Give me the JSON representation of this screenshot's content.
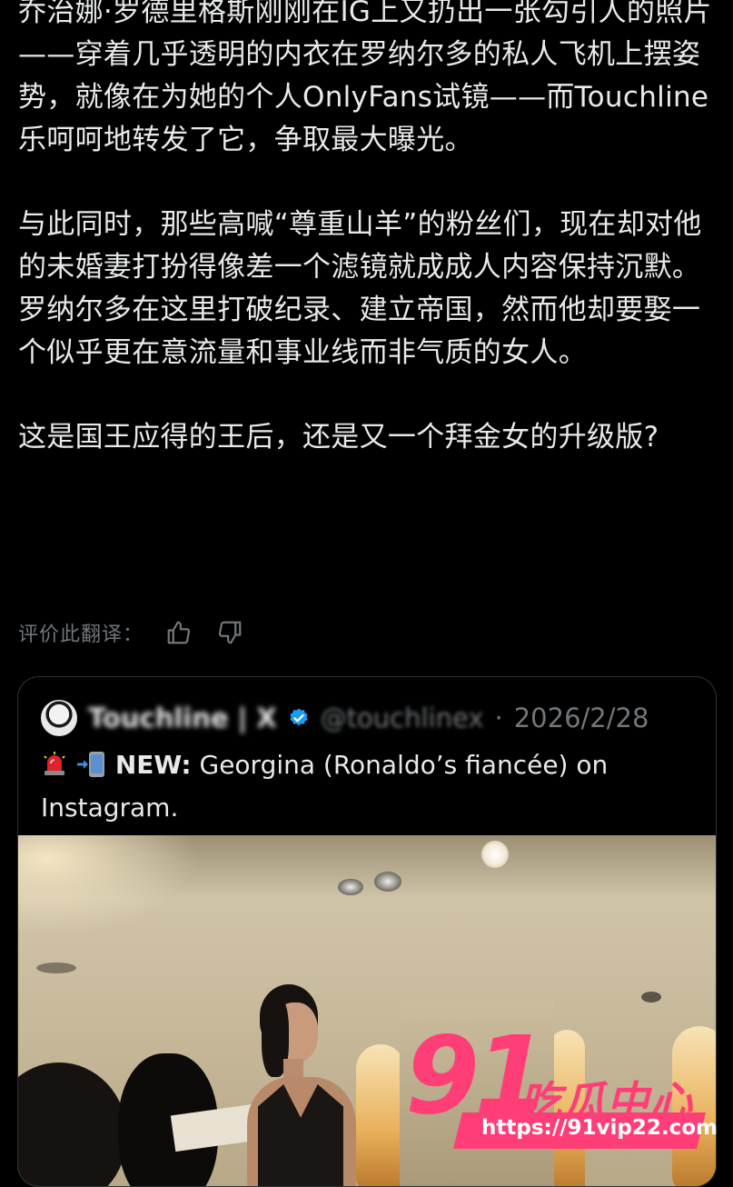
{
  "post": {
    "paragraphs": [
      "乔治娜·罗德里格斯刚刚在IG上又扔出一张勾引人的照片——穿着几乎透明的内衣在罗纳尔多的私人飞机上摆姿势，就像在为她的个人OnlyFans试镜——而Touchline乐呵呵地转发了它，争取最大曝光。",
      "与此同时，那些高喊“尊重山羊”的粉丝们，现在却对他的未婚妻打扮得像差一个滤镜就成成人内容保持沉默。罗纳尔多在这里打破纪录、建立帝国，然而他却要娶一个似乎更在意流量和事业线而非气质的女人。",
      "这是国王应得的王后，还是又一个拜金女的升级版?"
    ],
    "rate_translation_label": "评价此翻译：",
    "thumbs_up_icon": "thumbs-up-icon",
    "thumbs_down_icon": "thumbs-down-icon"
  },
  "quote": {
    "author_name": "Touchline | X",
    "verified_icon": "verified-badge-icon",
    "handle": "@touchlinex",
    "separator": "·",
    "date": "2026/2/28",
    "emoji_1": "🚨",
    "emoji_2": "📲",
    "new_label": "NEW:",
    "text": " Georgina (Ronaldo’s fiancée) on Instagram."
  },
  "watermark": {
    "number": "91",
    "brand": "吃瓜中心",
    "url": "https://91vip22.com"
  },
  "colors": {
    "background": "#000000",
    "text_primary": "#e7e9ea",
    "text_secondary": "#71767b",
    "border": "#2f3336",
    "watermark_pink": "#ff3e78",
    "verified_blue": "#1d9bf0"
  }
}
